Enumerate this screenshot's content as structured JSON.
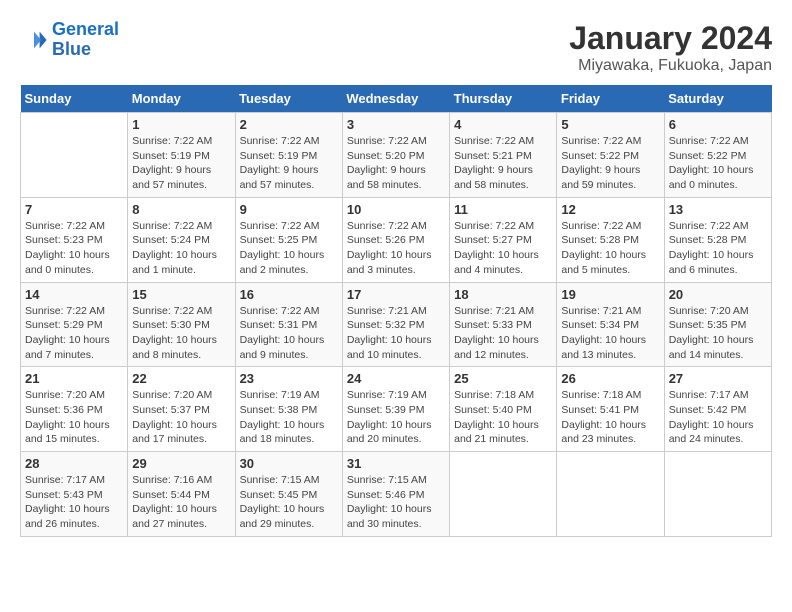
{
  "header": {
    "logo_line1": "General",
    "logo_line2": "Blue",
    "title": "January 2024",
    "subtitle": "Miyawaka, Fukuoka, Japan"
  },
  "weekdays": [
    "Sunday",
    "Monday",
    "Tuesday",
    "Wednesday",
    "Thursday",
    "Friday",
    "Saturday"
  ],
  "weeks": [
    [
      {
        "day": "",
        "info": ""
      },
      {
        "day": "1",
        "info": "Sunrise: 7:22 AM\nSunset: 5:19 PM\nDaylight: 9 hours\nand 57 minutes."
      },
      {
        "day": "2",
        "info": "Sunrise: 7:22 AM\nSunset: 5:19 PM\nDaylight: 9 hours\nand 57 minutes."
      },
      {
        "day": "3",
        "info": "Sunrise: 7:22 AM\nSunset: 5:20 PM\nDaylight: 9 hours\nand 58 minutes."
      },
      {
        "day": "4",
        "info": "Sunrise: 7:22 AM\nSunset: 5:21 PM\nDaylight: 9 hours\nand 58 minutes."
      },
      {
        "day": "5",
        "info": "Sunrise: 7:22 AM\nSunset: 5:22 PM\nDaylight: 9 hours\nand 59 minutes."
      },
      {
        "day": "6",
        "info": "Sunrise: 7:22 AM\nSunset: 5:22 PM\nDaylight: 10 hours\nand 0 minutes."
      }
    ],
    [
      {
        "day": "7",
        "info": "Sunrise: 7:22 AM\nSunset: 5:23 PM\nDaylight: 10 hours\nand 0 minutes."
      },
      {
        "day": "8",
        "info": "Sunrise: 7:22 AM\nSunset: 5:24 PM\nDaylight: 10 hours\nand 1 minute."
      },
      {
        "day": "9",
        "info": "Sunrise: 7:22 AM\nSunset: 5:25 PM\nDaylight: 10 hours\nand 2 minutes."
      },
      {
        "day": "10",
        "info": "Sunrise: 7:22 AM\nSunset: 5:26 PM\nDaylight: 10 hours\nand 3 minutes."
      },
      {
        "day": "11",
        "info": "Sunrise: 7:22 AM\nSunset: 5:27 PM\nDaylight: 10 hours\nand 4 minutes."
      },
      {
        "day": "12",
        "info": "Sunrise: 7:22 AM\nSunset: 5:28 PM\nDaylight: 10 hours\nand 5 minutes."
      },
      {
        "day": "13",
        "info": "Sunrise: 7:22 AM\nSunset: 5:28 PM\nDaylight: 10 hours\nand 6 minutes."
      }
    ],
    [
      {
        "day": "14",
        "info": "Sunrise: 7:22 AM\nSunset: 5:29 PM\nDaylight: 10 hours\nand 7 minutes."
      },
      {
        "day": "15",
        "info": "Sunrise: 7:22 AM\nSunset: 5:30 PM\nDaylight: 10 hours\nand 8 minutes."
      },
      {
        "day": "16",
        "info": "Sunrise: 7:22 AM\nSunset: 5:31 PM\nDaylight: 10 hours\nand 9 minutes."
      },
      {
        "day": "17",
        "info": "Sunrise: 7:21 AM\nSunset: 5:32 PM\nDaylight: 10 hours\nand 10 minutes."
      },
      {
        "day": "18",
        "info": "Sunrise: 7:21 AM\nSunset: 5:33 PM\nDaylight: 10 hours\nand 12 minutes."
      },
      {
        "day": "19",
        "info": "Sunrise: 7:21 AM\nSunset: 5:34 PM\nDaylight: 10 hours\nand 13 minutes."
      },
      {
        "day": "20",
        "info": "Sunrise: 7:20 AM\nSunset: 5:35 PM\nDaylight: 10 hours\nand 14 minutes."
      }
    ],
    [
      {
        "day": "21",
        "info": "Sunrise: 7:20 AM\nSunset: 5:36 PM\nDaylight: 10 hours\nand 15 minutes."
      },
      {
        "day": "22",
        "info": "Sunrise: 7:20 AM\nSunset: 5:37 PM\nDaylight: 10 hours\nand 17 minutes."
      },
      {
        "day": "23",
        "info": "Sunrise: 7:19 AM\nSunset: 5:38 PM\nDaylight: 10 hours\nand 18 minutes."
      },
      {
        "day": "24",
        "info": "Sunrise: 7:19 AM\nSunset: 5:39 PM\nDaylight: 10 hours\nand 20 minutes."
      },
      {
        "day": "25",
        "info": "Sunrise: 7:18 AM\nSunset: 5:40 PM\nDaylight: 10 hours\nand 21 minutes."
      },
      {
        "day": "26",
        "info": "Sunrise: 7:18 AM\nSunset: 5:41 PM\nDaylight: 10 hours\nand 23 minutes."
      },
      {
        "day": "27",
        "info": "Sunrise: 7:17 AM\nSunset: 5:42 PM\nDaylight: 10 hours\nand 24 minutes."
      }
    ],
    [
      {
        "day": "28",
        "info": "Sunrise: 7:17 AM\nSunset: 5:43 PM\nDaylight: 10 hours\nand 26 minutes."
      },
      {
        "day": "29",
        "info": "Sunrise: 7:16 AM\nSunset: 5:44 PM\nDaylight: 10 hours\nand 27 minutes."
      },
      {
        "day": "30",
        "info": "Sunrise: 7:15 AM\nSunset: 5:45 PM\nDaylight: 10 hours\nand 29 minutes."
      },
      {
        "day": "31",
        "info": "Sunrise: 7:15 AM\nSunset: 5:46 PM\nDaylight: 10 hours\nand 30 minutes."
      },
      {
        "day": "",
        "info": ""
      },
      {
        "day": "",
        "info": ""
      },
      {
        "day": "",
        "info": ""
      }
    ]
  ]
}
